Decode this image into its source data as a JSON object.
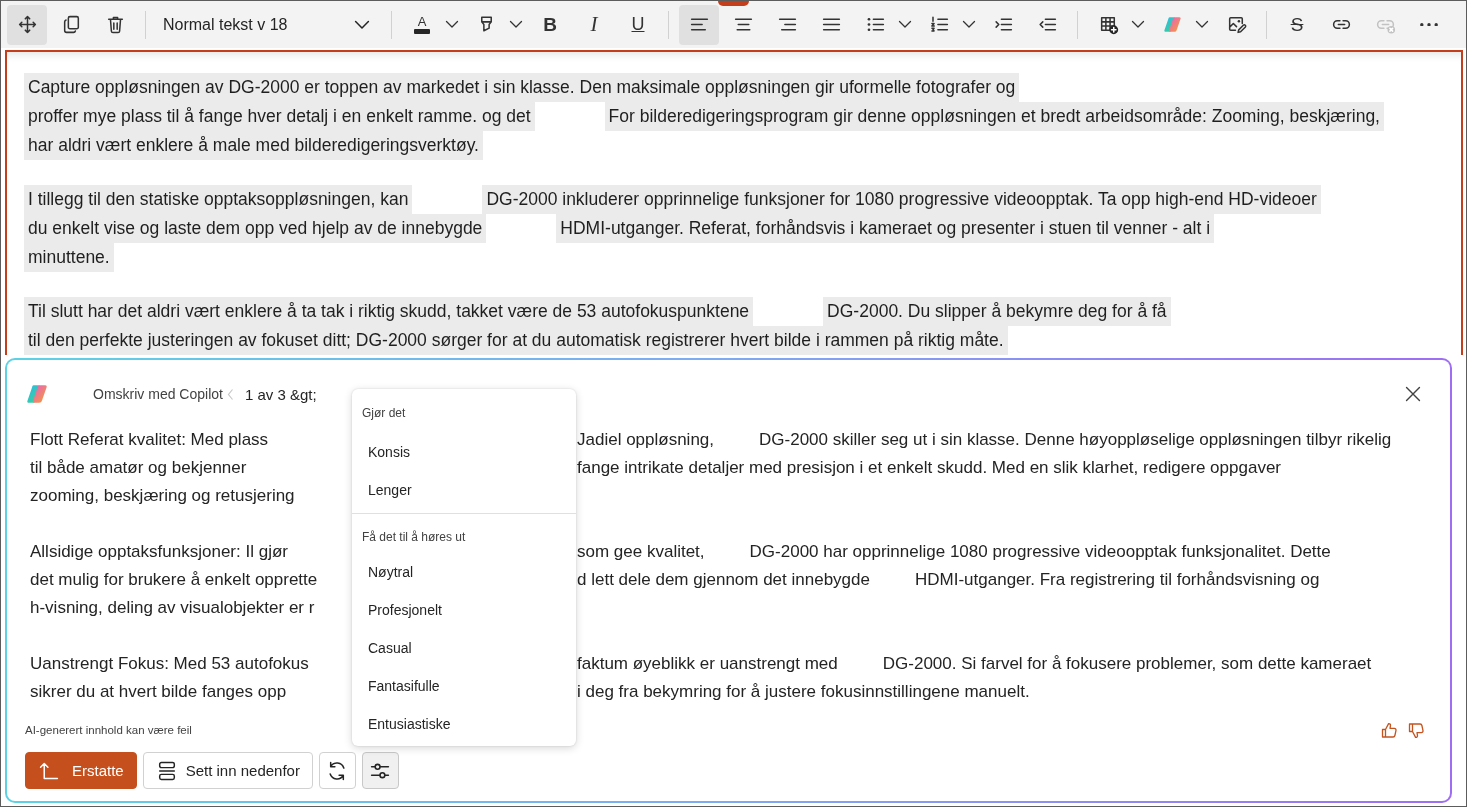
{
  "toolbar": {
    "groups": [
      {
        "items": [
          {
            "kind": "move",
            "selected": true,
            "disabled": false,
            "dropdown": false
          },
          {
            "kind": "copy",
            "selected": false,
            "disabled": false,
            "dropdown": false
          },
          {
            "kind": "delete",
            "selected": false,
            "disabled": false,
            "dropdown": false
          }
        ]
      },
      {
        "items": [
          {
            "kind": "style",
            "label": "Normal tekst v 18",
            "selected": false,
            "disabled": false,
            "dropdown": true
          }
        ]
      },
      {
        "items": [
          {
            "kind": "font-color",
            "label": "A",
            "selected": false,
            "disabled": false,
            "dropdown": true
          },
          {
            "kind": "highlight",
            "selected": false,
            "disabled": false,
            "dropdown": true
          },
          {
            "kind": "bold",
            "label": "B",
            "selected": false,
            "disabled": false,
            "dropdown": false
          },
          {
            "kind": "italic",
            "label": "I",
            "selected": false,
            "disabled": false,
            "dropdown": false
          },
          {
            "kind": "underline",
            "label": "U",
            "selected": false,
            "disabled": false,
            "dropdown": false
          }
        ]
      },
      {
        "items": [
          {
            "kind": "align-left",
            "selected": true,
            "disabled": false,
            "dropdown": false
          },
          {
            "kind": "align-center",
            "selected": false,
            "disabled": false,
            "dropdown": false
          },
          {
            "kind": "align-right",
            "selected": false,
            "disabled": false,
            "dropdown": false
          },
          {
            "kind": "justify",
            "selected": false,
            "disabled": false,
            "dropdown": false
          },
          {
            "kind": "bullets",
            "selected": false,
            "disabled": false,
            "dropdown": true
          },
          {
            "kind": "numbering",
            "selected": false,
            "disabled": false,
            "dropdown": true
          },
          {
            "kind": "indent",
            "selected": false,
            "disabled": false,
            "dropdown": false
          },
          {
            "kind": "outdent",
            "selected": false,
            "disabled": false,
            "dropdown": false
          }
        ]
      },
      {
        "items": [
          {
            "kind": "table",
            "selected": false,
            "disabled": false,
            "dropdown": true
          },
          {
            "kind": "assistant",
            "selected": false,
            "disabled": false,
            "dropdown": true
          },
          {
            "kind": "image-edit",
            "selected": false,
            "disabled": false,
            "dropdown": false
          }
        ]
      },
      {
        "items": [
          {
            "kind": "strikethrough",
            "label": "S",
            "selected": false,
            "disabled": false,
            "dropdown": false
          },
          {
            "kind": "link",
            "selected": false,
            "disabled": false,
            "dropdown": false
          },
          {
            "kind": "unlink",
            "selected": false,
            "disabled": true,
            "dropdown": false
          },
          {
            "kind": "more",
            "selected": false,
            "disabled": false,
            "dropdown": false
          }
        ]
      }
    ]
  },
  "document": {
    "paragraphs": [
      {
        "lines": [
          [
            "Capture oppløsningen av DG-2000 er toppen av markedet i sin klasse. Den maksimale oppløsningen gir uformelle fotografer og"
          ],
          [
            "proffer mye plass til å fange hver detalj i en enkelt ramme. og det",
            "For bilderedigeringsprogram gir denne oppløsningen et bredt arbeidsområde: Zooming, beskjæring,"
          ],
          [
            "har aldri vært enklere å male med bilderedigeringsverktøy."
          ]
        ]
      },
      {
        "lines": [
          [
            "I tillegg til den statiske opptaksoppløsningen, kan",
            "DG-2000 inkluderer opprinnelige funksjoner for 1080 progressive videoopptak. Ta opp high-end HD-videoer"
          ],
          [
            "du enkelt vise og laste dem opp ved hjelp av de innebygde",
            "HDMI-utganger. Referat, forhåndsvis i kameraet og presenter i stuen til venner - alt i"
          ],
          [
            "minuttene."
          ]
        ]
      },
      {
        "lines": [
          [
            "Til slutt har det aldri vært enklere å ta tak i riktig skudd, takket være de 53 autofokuspunktene",
            "DG-2000. Du slipper å bekymre deg for å få"
          ],
          [
            "til den perfekte justeringen av fokuset ditt; DG-2000 sørger for at du automatisk registrerer hvert bilde i rammen på riktig måte."
          ]
        ]
      }
    ]
  },
  "copilot": {
    "title": "Omskriv med Copilot",
    "counter": "1 av 3 &gt;",
    "paragraphs": [
      {
        "lines": [
          {
            "left": "Flott Referat kvalitet: Med plass",
            "right": [
              "Jadiel oppløsning,",
              "DG-2000 skiller seg ut i sin klasse. Denne høyoppløselige oppløsningen tilbyr rikelig"
            ]
          },
          {
            "left": "til både amatør og bekjenner",
            "right": [
              "fange intrikate detaljer med presisjon i et enkelt skudd. Med en slik klarhet, redigere oppgaver"
            ]
          },
          {
            "left": "zooming, beskjæring og retusjering"
          }
        ]
      },
      {
        "lines": [
          {
            "left": "Allsidige opptaksfunksjoner: Il gjør",
            "right": [
              "som gee kvalitet,",
              "DG-2000 har opprinnelige 1080 progressive videoopptak funksjonalitet. Dette"
            ]
          },
          {
            "left": "det mulig for brukere å enkelt opprette",
            "right": [
              "d lett dele dem gjennom det innebygde",
              "HDMI-utganger. Fra registrering til forhåndsvisning og"
            ]
          },
          {
            "left": "h-visning, deling av visualobjekter er r"
          }
        ]
      },
      {
        "lines": [
          {
            "left": "Uanstrengt Fokus: Med 53 autofokus",
            "right": [
              "faktum øyeblikk er uanstrengt med",
              "DG-2000. Si farvel for å fokusere problemer, som dette kameraet"
            ]
          },
          {
            "left": "sikrer du at hvert bilde fanges opp",
            "right": [
              "i deg fra bekymring for å justere fokusinnstillingene manuelt."
            ]
          }
        ]
      }
    ],
    "disclaimer": "AI-generert innhold kan være feil",
    "actions": [
      {
        "kind": "replace",
        "label": "Erstatte",
        "selected": false
      },
      {
        "kind": "insert-below",
        "label": "Sett inn nedenfor",
        "selected": false
      },
      {
        "kind": "regenerate",
        "selected": false
      },
      {
        "kind": "adjust",
        "selected": true
      }
    ],
    "menu": {
      "sections": [
        {
          "heading": "Gjør det",
          "items": [
            "Konsis",
            "Lenger"
          ]
        },
        {
          "heading": "Få det til å høres ut",
          "items": [
            "Nøytral",
            "Profesjonelt",
            "Casual",
            "Fantasifulle",
            "Entusiastiske"
          ]
        }
      ]
    }
  }
}
